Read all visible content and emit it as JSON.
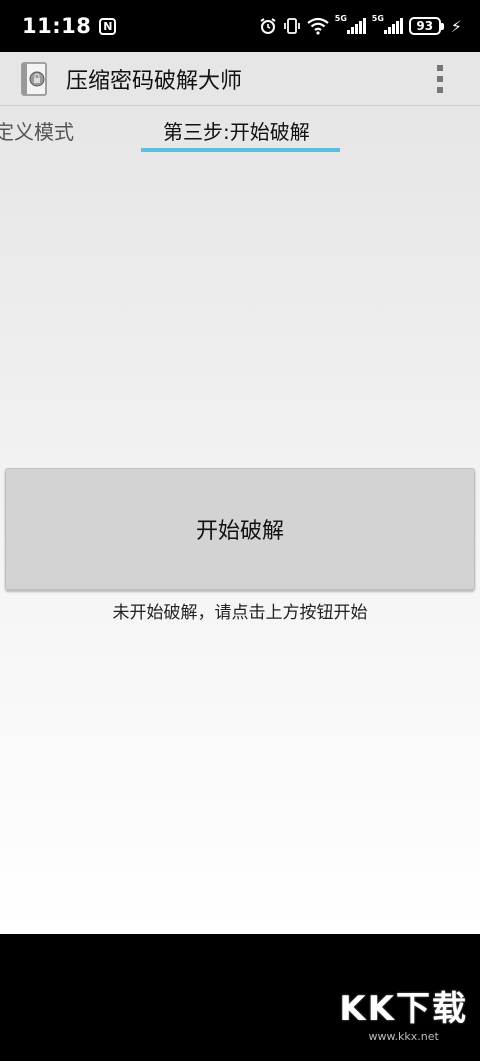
{
  "status_bar": {
    "time": "11:18",
    "nfc": "N",
    "signal1_label": "5G",
    "signal2_label": "5G",
    "battery": "93"
  },
  "action_bar": {
    "title": "压缩密码破解大师"
  },
  "tabs": {
    "previous": "定义模式",
    "current": "第三步:开始破解"
  },
  "main": {
    "start_button_label": "开始破解",
    "status_text": "未开始破解，请点击上方按钮开始"
  },
  "watermark": {
    "logo": "KK下载",
    "url": "www.kkx.net"
  },
  "colors": {
    "tab_indicator": "#5bbfe2",
    "button_bg": "#d3d3d3",
    "action_bar_bg": "#e6e6e6"
  }
}
